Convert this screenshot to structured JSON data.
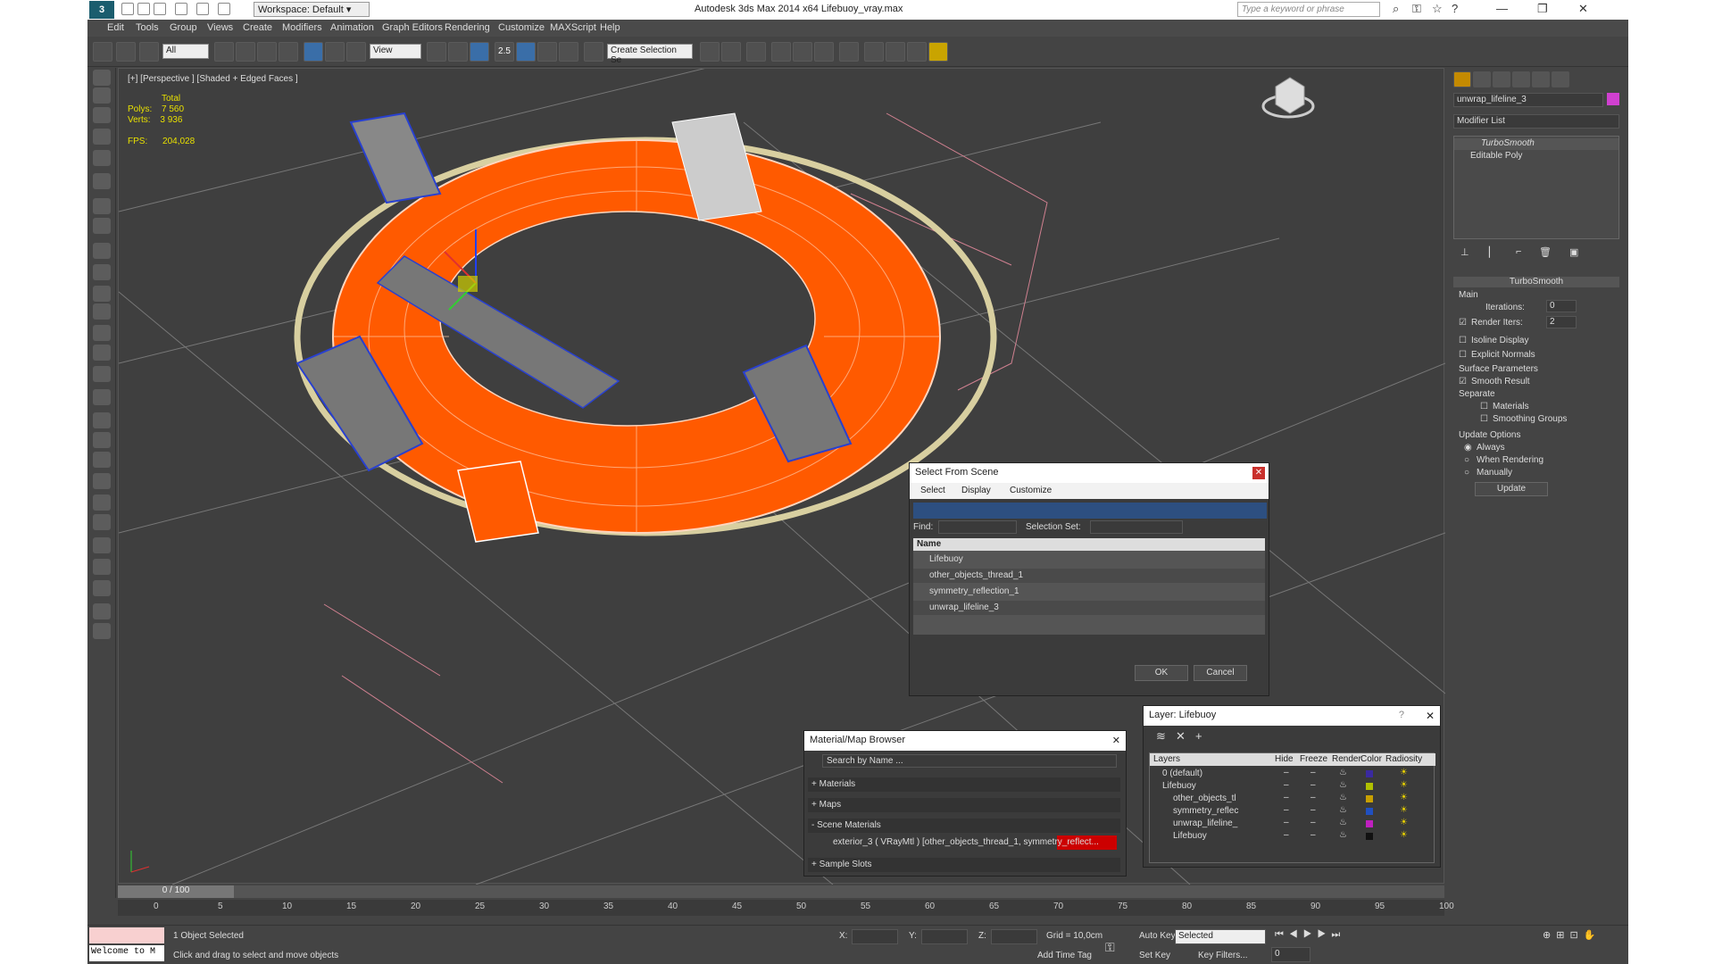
{
  "titlebar": {
    "workspace": "Workspace: Default",
    "app_title": "Autodesk 3ds Max  2014 x64      Lifebuoy_vray.max",
    "search_placeholder": "Type a keyword or phrase",
    "logo": "3"
  },
  "menu": [
    "Edit",
    "Tools",
    "Group",
    "Views",
    "Create",
    "Modifiers",
    "Animation",
    "Graph Editors",
    "Rendering",
    "Customize",
    "MAXScript",
    "Help"
  ],
  "toolbar": {
    "filter": "All",
    "ref_coord": "View",
    "snap_value": "2.5",
    "selection_set": "Create Selection Se"
  },
  "viewport": {
    "label": "[+] [Perspective ] [Shaded + Edged Faces ]",
    "stats": {
      "total_label": "Total",
      "polys_label": "Polys:",
      "polys": "7 560",
      "verts_label": "Verts:",
      "verts": "3 936",
      "fps_label": "FPS:",
      "fps": "204,028"
    },
    "accent": "#ff5a00"
  },
  "command_panel": {
    "object_name": "unwrap_lifeline_3",
    "modifier_list": "Modifier List",
    "stack": [
      "TurboSmooth",
      "Editable Poly"
    ],
    "rollout": "TurboSmooth",
    "main": "Main",
    "iterations_label": "Iterations:",
    "iterations": "0",
    "render_iters_label": "Render Iters:",
    "render_iters": "2",
    "isoline": "Isoline Display",
    "explicit": "Explicit Normals",
    "surface": "Surface Parameters",
    "smooth_result": "Smooth Result",
    "separate": "Separate",
    "materials": "Materials",
    "smoothing": "Smoothing Groups",
    "update_options": "Update Options",
    "always": "Always",
    "when_rendering": "When Rendering",
    "manually": "Manually",
    "update_btn": "Update"
  },
  "select_dialog": {
    "title": "Select From Scene",
    "tabs": [
      "Select",
      "Display",
      "Customize"
    ],
    "find_label": "Find:",
    "selset_label": "Selection Set:",
    "col_name": "Name",
    "items": [
      "Lifebuoy",
      "other_objects_thread_1",
      "symmetry_reflection_1",
      "unwrap_lifeline_3"
    ],
    "ok": "OK",
    "cancel": "Cancel"
  },
  "material_browser": {
    "title": "Material/Map Browser",
    "search": "Search by Name ...",
    "materials": "+ Materials",
    "maps": "+ Maps",
    "scene_materials": "- Scene Materials",
    "entry": "exterior_3  ( VRayMtl )  [other_objects_thread_1, symmetry_reflect...",
    "sample_slots": "+ Sample Slots"
  },
  "layer_dialog": {
    "title": "Layer: Lifebuoy",
    "headers": [
      "Layers",
      "Hide",
      "Freeze",
      "Render",
      "Color",
      "Radiosity"
    ],
    "rows": [
      {
        "name": "0 (default)",
        "color": "#3a2aa0"
      },
      {
        "name": "Lifebuoy",
        "color": "#b0c000"
      },
      {
        "name": "other_objects_tl",
        "color": "#c8a000"
      },
      {
        "name": "symmetry_reflec",
        "color": "#2050c0"
      },
      {
        "name": "unwrap_lifeline_",
        "color": "#c020c0"
      },
      {
        "name": "Lifebuoy",
        "color": "#111111"
      }
    ]
  },
  "timeline": {
    "frame": "0 / 100",
    "ticks": [
      "0",
      "5",
      "10",
      "15",
      "20",
      "25",
      "30",
      "35",
      "40",
      "45",
      "50",
      "55",
      "60",
      "65",
      "70",
      "75",
      "80",
      "85",
      "90",
      "95",
      "100"
    ]
  },
  "status": {
    "selected": "1 Object Selected",
    "hint": "Click and drag to select and move objects",
    "listener": "Welcome to M",
    "x_label": "X:",
    "y_label": "Y:",
    "z_label": "Z:",
    "grid": "Grid = 10,0cm",
    "auto_key": "Auto Key",
    "set_key": "Set Key",
    "key_mode": "Selected",
    "key_filters": "Key Filters...",
    "add_time_tag": "Add Time Tag",
    "frame_field": "0"
  }
}
